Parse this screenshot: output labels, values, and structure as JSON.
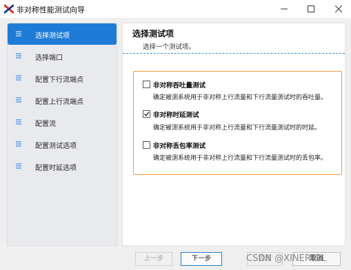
{
  "window": {
    "title": "非对称性能测试向导",
    "logo_icon": "red-x-logo",
    "controls": [
      "minimize-icon",
      "maximize-icon",
      "close-icon"
    ]
  },
  "sidebar": {
    "items": [
      {
        "label": "选择测试项",
        "active": true
      },
      {
        "label": "选择端口",
        "active": false
      },
      {
        "label": "配置下行流端点",
        "active": false
      },
      {
        "label": "配置上行流端点",
        "active": false
      },
      {
        "label": "配置流",
        "active": false
      },
      {
        "label": "配置测试选项",
        "active": false
      },
      {
        "label": "配置时延选项",
        "active": false
      }
    ],
    "item_icon": "list-icon"
  },
  "main": {
    "title": "选择测试项",
    "subtitle": "选择一个测试项。",
    "options": [
      {
        "title": "非对称吞吐量测试",
        "checked": false,
        "description": "确定被测系统用于非对称上行流量和下行流量测试时的吞吐量。"
      },
      {
        "title": "非对称时延测试",
        "checked": true,
        "description": "确定被测系统用于非对称上行流量和下行流量测试时的时延。"
      },
      {
        "title": "非对称丢包率测试",
        "checked": false,
        "description": "确定被测系统用于非对称上行流量和下行流量测试时的丢包率。"
      }
    ]
  },
  "footer": {
    "prev_label": "上一步",
    "next_label": "下一步",
    "finish_label": "完成",
    "cancel_label": "取消"
  },
  "watermark": "CSDN @XINERTEL",
  "colors": {
    "accent": "#1f7cd6",
    "highlight_border": "#f29a3a",
    "sidebar_bg": "#e9eaee"
  }
}
